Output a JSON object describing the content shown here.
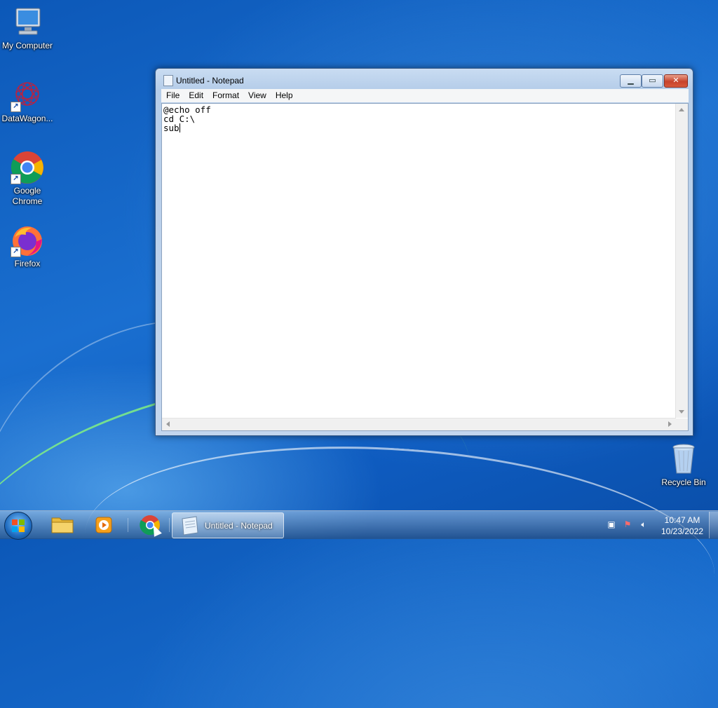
{
  "desktop": {
    "icons": [
      {
        "label": "My Computer",
        "icon": "computer-icon"
      },
      {
        "label": "DataWagon...",
        "icon": "datawagon-icon"
      },
      {
        "label": "Google Chrome",
        "icon": "chrome-icon"
      },
      {
        "label": "Firefox",
        "icon": "firefox-icon"
      },
      {
        "label": "Recycle Bin",
        "icon": "recycle-bin-icon"
      }
    ],
    "shortcut_arrow": "↗"
  },
  "notepad": {
    "title": "Untitled - Notepad",
    "minimize_glyph": "▁",
    "maximize_glyph": "▭",
    "close_glyph": "✕",
    "menu": [
      "File",
      "Edit",
      "Format",
      "View",
      "Help"
    ],
    "text": "@echo off\ncd C:\\\nsub"
  },
  "taskbar": {
    "active_window_label": "Untitled - Notepad",
    "tray_icons": [
      "network-icon",
      "action-center-flag-icon",
      "volume-icon"
    ],
    "clock_time": "10:47 AM",
    "clock_date": "10/23/2022"
  },
  "colors": {
    "desktop_blue": "#1a6fd0",
    "close_red": "#c7432b"
  }
}
